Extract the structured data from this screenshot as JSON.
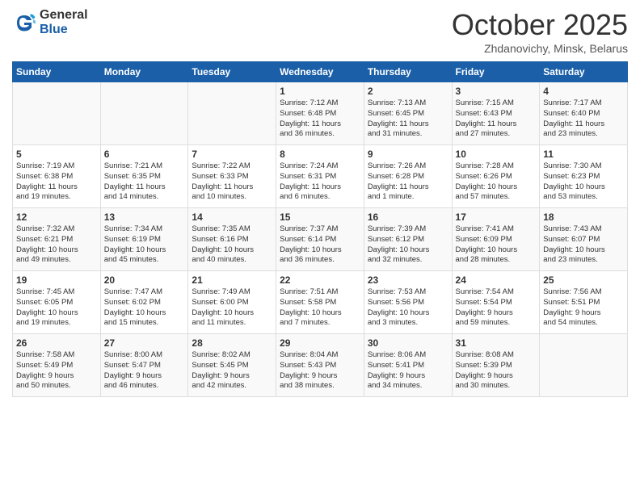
{
  "header": {
    "logo_general": "General",
    "logo_blue": "Blue",
    "month_title": "October 2025",
    "subtitle": "Zhdanovichy, Minsk, Belarus"
  },
  "days_of_week": [
    "Sunday",
    "Monday",
    "Tuesday",
    "Wednesday",
    "Thursday",
    "Friday",
    "Saturday"
  ],
  "weeks": [
    [
      {
        "day": "",
        "info": ""
      },
      {
        "day": "",
        "info": ""
      },
      {
        "day": "",
        "info": ""
      },
      {
        "day": "1",
        "info": "Sunrise: 7:12 AM\nSunset: 6:48 PM\nDaylight: 11 hours\nand 36 minutes."
      },
      {
        "day": "2",
        "info": "Sunrise: 7:13 AM\nSunset: 6:45 PM\nDaylight: 11 hours\nand 31 minutes."
      },
      {
        "day": "3",
        "info": "Sunrise: 7:15 AM\nSunset: 6:43 PM\nDaylight: 11 hours\nand 27 minutes."
      },
      {
        "day": "4",
        "info": "Sunrise: 7:17 AM\nSunset: 6:40 PM\nDaylight: 11 hours\nand 23 minutes."
      }
    ],
    [
      {
        "day": "5",
        "info": "Sunrise: 7:19 AM\nSunset: 6:38 PM\nDaylight: 11 hours\nand 19 minutes."
      },
      {
        "day": "6",
        "info": "Sunrise: 7:21 AM\nSunset: 6:35 PM\nDaylight: 11 hours\nand 14 minutes."
      },
      {
        "day": "7",
        "info": "Sunrise: 7:22 AM\nSunset: 6:33 PM\nDaylight: 11 hours\nand 10 minutes."
      },
      {
        "day": "8",
        "info": "Sunrise: 7:24 AM\nSunset: 6:31 PM\nDaylight: 11 hours\nand 6 minutes."
      },
      {
        "day": "9",
        "info": "Sunrise: 7:26 AM\nSunset: 6:28 PM\nDaylight: 11 hours\nand 1 minute."
      },
      {
        "day": "10",
        "info": "Sunrise: 7:28 AM\nSunset: 6:26 PM\nDaylight: 10 hours\nand 57 minutes."
      },
      {
        "day": "11",
        "info": "Sunrise: 7:30 AM\nSunset: 6:23 PM\nDaylight: 10 hours\nand 53 minutes."
      }
    ],
    [
      {
        "day": "12",
        "info": "Sunrise: 7:32 AM\nSunset: 6:21 PM\nDaylight: 10 hours\nand 49 minutes."
      },
      {
        "day": "13",
        "info": "Sunrise: 7:34 AM\nSunset: 6:19 PM\nDaylight: 10 hours\nand 45 minutes."
      },
      {
        "day": "14",
        "info": "Sunrise: 7:35 AM\nSunset: 6:16 PM\nDaylight: 10 hours\nand 40 minutes."
      },
      {
        "day": "15",
        "info": "Sunrise: 7:37 AM\nSunset: 6:14 PM\nDaylight: 10 hours\nand 36 minutes."
      },
      {
        "day": "16",
        "info": "Sunrise: 7:39 AM\nSunset: 6:12 PM\nDaylight: 10 hours\nand 32 minutes."
      },
      {
        "day": "17",
        "info": "Sunrise: 7:41 AM\nSunset: 6:09 PM\nDaylight: 10 hours\nand 28 minutes."
      },
      {
        "day": "18",
        "info": "Sunrise: 7:43 AM\nSunset: 6:07 PM\nDaylight: 10 hours\nand 23 minutes."
      }
    ],
    [
      {
        "day": "19",
        "info": "Sunrise: 7:45 AM\nSunset: 6:05 PM\nDaylight: 10 hours\nand 19 minutes."
      },
      {
        "day": "20",
        "info": "Sunrise: 7:47 AM\nSunset: 6:02 PM\nDaylight: 10 hours\nand 15 minutes."
      },
      {
        "day": "21",
        "info": "Sunrise: 7:49 AM\nSunset: 6:00 PM\nDaylight: 10 hours\nand 11 minutes."
      },
      {
        "day": "22",
        "info": "Sunrise: 7:51 AM\nSunset: 5:58 PM\nDaylight: 10 hours\nand 7 minutes."
      },
      {
        "day": "23",
        "info": "Sunrise: 7:53 AM\nSunset: 5:56 PM\nDaylight: 10 hours\nand 3 minutes."
      },
      {
        "day": "24",
        "info": "Sunrise: 7:54 AM\nSunset: 5:54 PM\nDaylight: 9 hours\nand 59 minutes."
      },
      {
        "day": "25",
        "info": "Sunrise: 7:56 AM\nSunset: 5:51 PM\nDaylight: 9 hours\nand 54 minutes."
      }
    ],
    [
      {
        "day": "26",
        "info": "Sunrise: 7:58 AM\nSunset: 5:49 PM\nDaylight: 9 hours\nand 50 minutes."
      },
      {
        "day": "27",
        "info": "Sunrise: 8:00 AM\nSunset: 5:47 PM\nDaylight: 9 hours\nand 46 minutes."
      },
      {
        "day": "28",
        "info": "Sunrise: 8:02 AM\nSunset: 5:45 PM\nDaylight: 9 hours\nand 42 minutes."
      },
      {
        "day": "29",
        "info": "Sunrise: 8:04 AM\nSunset: 5:43 PM\nDaylight: 9 hours\nand 38 minutes."
      },
      {
        "day": "30",
        "info": "Sunrise: 8:06 AM\nSunset: 5:41 PM\nDaylight: 9 hours\nand 34 minutes."
      },
      {
        "day": "31",
        "info": "Sunrise: 8:08 AM\nSunset: 5:39 PM\nDaylight: 9 hours\nand 30 minutes."
      },
      {
        "day": "",
        "info": ""
      }
    ]
  ]
}
